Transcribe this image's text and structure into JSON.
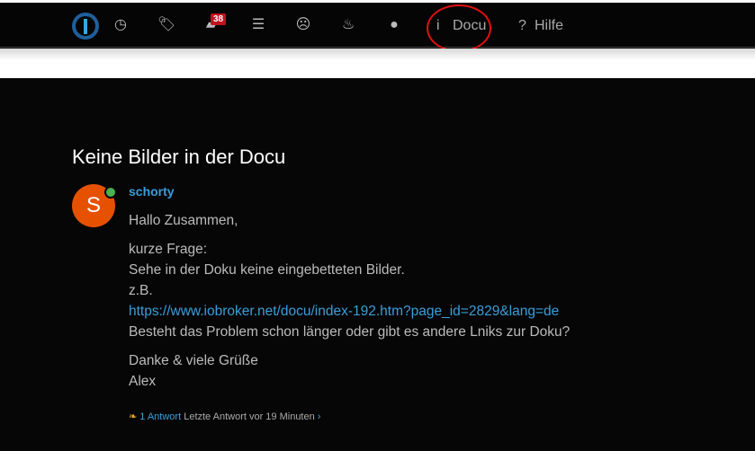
{
  "nav": {
    "badge": "38",
    "docu": "Docu",
    "hilfe": "Hilfe",
    "docu_icon": "i",
    "hilfe_icon": "?"
  },
  "topic": {
    "title": "Keine Bilder in der Docu"
  },
  "post": {
    "avatar_letter": "S",
    "username": "schorty",
    "greeting": "Hallo Zusammen,",
    "line1": "kurze Frage:",
    "line2": "Sehe in der Doku keine eingebetteten Bilder.",
    "line3": "z.B.",
    "link": "https://www.iobroker.net/docu/index-192.htm?page_id=2829&lang=de",
    "line4": "Besteht das Problem schon länger oder gibt es andere Lniks zur Doku?",
    "closing1": "Danke & viele Grüße",
    "closing2": "Alex"
  },
  "footer": {
    "replies": "1 Antwort",
    "last": "Letzte Antwort vor 19 Minuten"
  }
}
